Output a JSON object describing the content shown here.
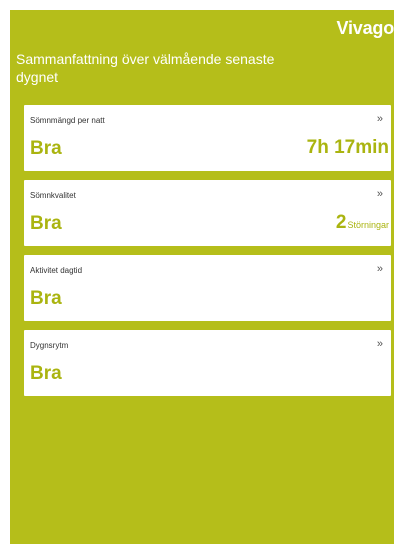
{
  "header": {
    "brand": "Vivago",
    "title": "Sammanfattning över välmående senaste dygnet"
  },
  "cards": [
    {
      "label": "Sömnmängd per natt",
      "status": "Bra",
      "metric": "7h 17min",
      "chevron": "»"
    },
    {
      "label": "Sömnkvalitet",
      "status": "Bra",
      "metric_value": "2",
      "metric_unit": "Störningar",
      "chevron": "»"
    },
    {
      "label": "Aktivitet dagtid",
      "status": "Bra",
      "chevron": "»"
    },
    {
      "label": "Dygnsrytm",
      "status": "Bra",
      "chevron": "»"
    }
  ],
  "colors": {
    "background": "#b5be1a",
    "card": "#ffffff",
    "accent_text": "#aab410"
  },
  "icons": {
    "chevron": "double-chevron-right-icon"
  }
}
